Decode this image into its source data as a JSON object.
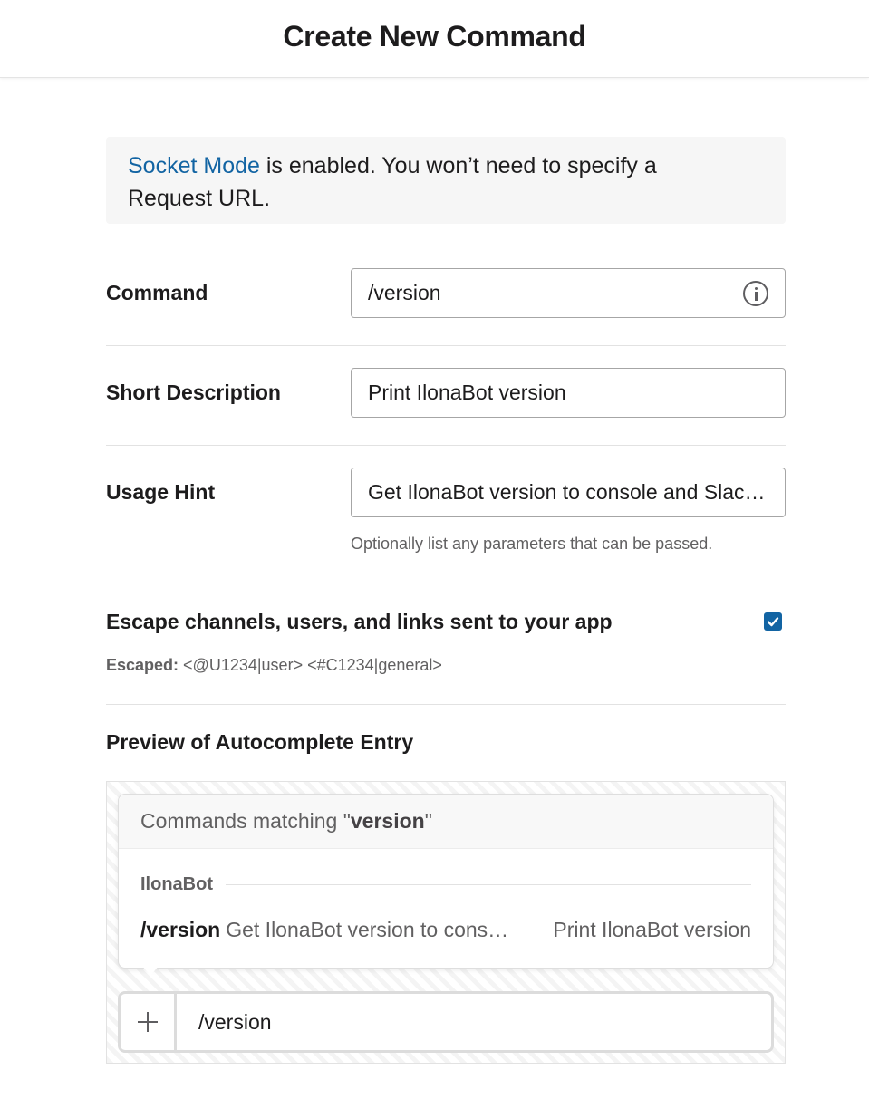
{
  "header": {
    "title": "Create New Command"
  },
  "banner": {
    "link_text": "Socket Mode",
    "text_line1": " is enabled. You won’t need to specify a",
    "text_line2": "Request URL."
  },
  "form": {
    "command": {
      "label": "Command",
      "value": "/version",
      "icon": "info-icon"
    },
    "short_description": {
      "label": "Short Description",
      "value": "Print IlonaBot version"
    },
    "usage_hint": {
      "label": "Usage Hint",
      "value": "Get IlonaBot version to console and Slac…",
      "helper": "Optionally list any parameters that can be passed."
    },
    "escape": {
      "label": "Escape channels, users, and links sent to your app",
      "checked": true,
      "escaped_label": "Escaped:",
      "escaped_example": " <@U1234|user> <#C1234|general>"
    }
  },
  "preview": {
    "title": "Preview of Autocomplete Entry",
    "header_prefix": "Commands matching \"",
    "header_term": "version",
    "header_suffix": "\"",
    "section": "IlonaBot",
    "item": {
      "command": "/version",
      "hint": "Get IlonaBot version to cons…",
      "description": "Print IlonaBot version"
    },
    "composer_text": "/version",
    "accent": "#1264a3"
  }
}
